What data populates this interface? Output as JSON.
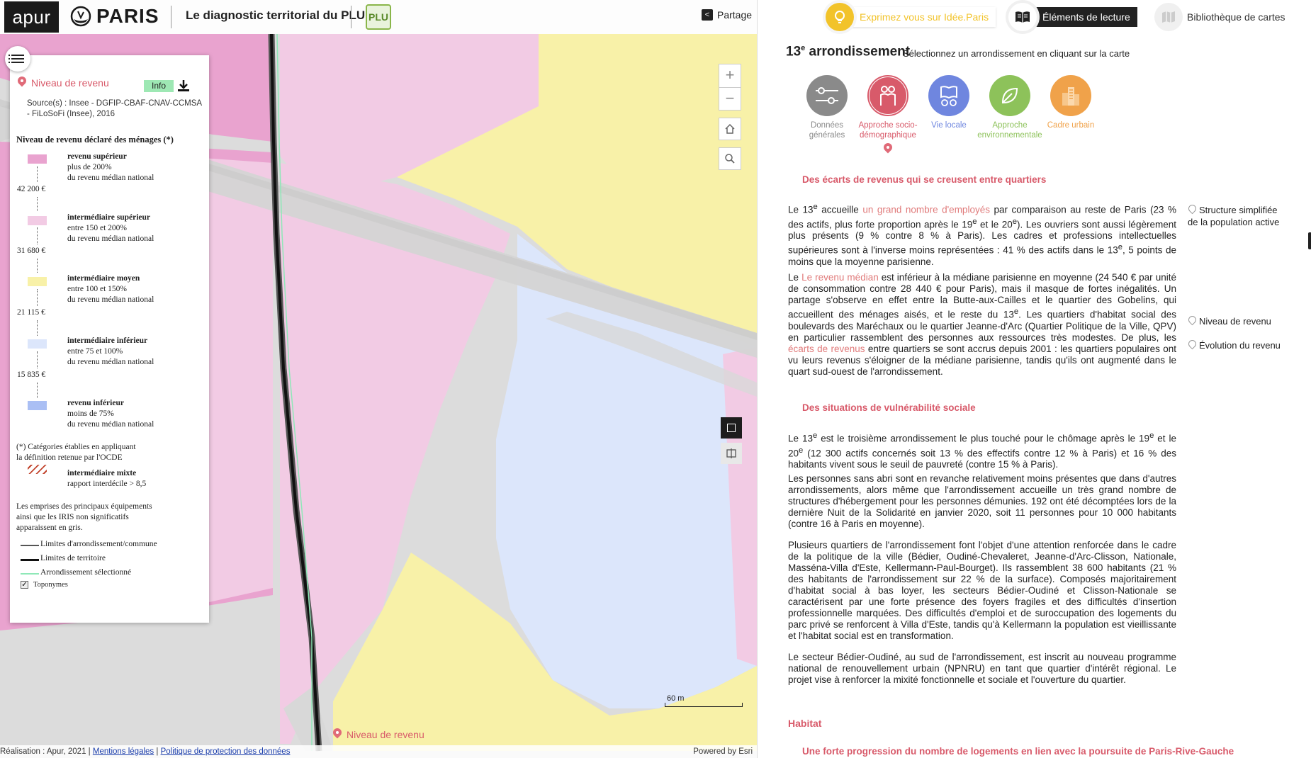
{
  "header": {
    "apur_logo": "apur",
    "paris_logo": "PARIS",
    "app_title": "Le diagnostic territorial du PLU",
    "plu_logo": "PLU",
    "share_label": "Partage"
  },
  "legend": {
    "layer_title": "Niveau de revenu",
    "info_label": "Info",
    "source": "Source(s) : Insee - DGFIP-CBAF-CNAV-CCMSA - FiLoSoFi (Insee), 2016",
    "subtitle": "Niveau de revenu déclaré des ménages (*)",
    "categories": [
      {
        "name": "revenu supérieur",
        "range": "plus de 200%",
        "ref": "du revenu médian national",
        "color": "#e9a3cf"
      },
      {
        "name": "intermédiaire supérieur",
        "range": "entre 150 et 200%",
        "ref": "du revenu médian national",
        "color": "#f2cbe4"
      },
      {
        "name": "intermédiaire moyen",
        "range": "entre 100 et 150%",
        "ref": "du revenu médian national",
        "color": "#f8f1a8"
      },
      {
        "name": "intermédiaire inférieur",
        "range": "entre 75 et 100%",
        "ref": "du revenu médian national",
        "color": "#dce6fb"
      },
      {
        "name": "revenu inférieur",
        "range": "moins de 75%",
        "ref": "du revenu médian national",
        "color": "#aabff4"
      }
    ],
    "thresholds": [
      "42 200 €",
      "31 680 €",
      "21 115 €",
      "15 835 €"
    ],
    "note_ocde_1": "(*) Catégories établies en appliquant",
    "note_ocde_2": "la définition retenue par l'OCDE",
    "mixte_name": "intermédiaire mixte",
    "mixte_desc": "rapport interdécile > 8,5",
    "grey_note_1": "Les emprises des principaux équipements",
    "grey_note_2": "ainsi que les IRIS non significatifs",
    "grey_note_3": "apparaissent en gris.",
    "lines": [
      {
        "label": "Limites d'arrondissement/commune",
        "color": "#555555"
      },
      {
        "label": "Limites de territoire",
        "color": "#111111"
      },
      {
        "label": "Arrondissement sélectionné",
        "color": "#8fe8b8"
      }
    ],
    "toponymes_label": "Toponymes"
  },
  "map": {
    "zoom_in": "+",
    "zoom_out": "−",
    "scale_label": "60 m",
    "bottom_layer_label": "Niveau de revenu"
  },
  "footer": {
    "realisation": "Réalisation : Apur, 2021 |",
    "legal": "Mentions légales",
    "sep": "|",
    "privacy": "Politique de protection des données",
    "powered": "Powered by Esri"
  },
  "panel": {
    "idea_label": "Exprimez vous sur Idée.Paris",
    "reading_label": "Éléments de lecture",
    "library_label": "Bibliothèque de cartes",
    "arr_number": "13",
    "arr_sup": "e",
    "arr_word": " arrondissement",
    "arr_hint": "Sélectionnez un arrondissement en cliquant sur la carte",
    "themes": [
      {
        "label1": "Données",
        "label2": "générales",
        "color": "#8a8a8a"
      },
      {
        "label1": "Approche socio-",
        "label2": "démographique",
        "color": "#d85a6a"
      },
      {
        "label1": "Vie locale",
        "label2": "",
        "color": "#6f86df"
      },
      {
        "label1": "Approche",
        "label2": "environnementale",
        "color": "#8dc25a"
      },
      {
        "label1": "Cadre urbain",
        "label2": "",
        "color": "#f0a24a"
      }
    ],
    "section1_title": "Des écarts de revenus qui se creusent entre quartiers",
    "p1_a": "Le 13",
    "p1_b": "e",
    "p1_c": " accueille ",
    "p1_link": "un grand nombre d'employés",
    "p1_d": " par comparaison au reste de Paris (23 % des actifs, plus forte proportion après le 19",
    "p1_e": "e",
    "p1_f": " et le 20",
    "p1_g": "e",
    "p1_h": "). Les ouvriers sont aussi légèrement plus présents (9 % contre 8 % à Paris). Les cadres et professions intellectuelles supérieures sont à l'inverse moins représentées : 41 % des actifs dans le 13",
    "p1_i": "e",
    "p1_j": ", 5 points de moins que la moyenne parisienne.",
    "p2_a": "Le ",
    "p2_link1": "Le revenu médian",
    "p2_b": " est inférieur à la médiane parisienne en moyenne (24 540 € par unité de consommation contre 28 440 € pour Paris), mais il masque de fortes inégalités. Un partage s'observe en effet entre la Butte-aux-Cailles et le quartier des Gobelins, qui accueillent des ménages aisés, et le reste du 13",
    "p2_c": "e",
    "p2_d": ". Les quartiers d'habitat social des boulevards des Maréchaux ou le quartier Jeanne-d'Arc (Quartier Politique de la Ville, QPV) en particulier rassemblent des personnes aux ressources très modestes. De plus, les ",
    "p2_link2": "écarts de revenus",
    "p2_e": " entre quartiers se sont accrus depuis 2001 : les quartiers populaires ont vu leurs revenus s'éloigner de la médiane parisienne, tandis qu'ils ont augmenté dans le quart sud-ouest de l'arrondissement.",
    "section2_title": "Des situations de vulnérabilité sociale",
    "p3_a": "Le 13",
    "p3_b": "e",
    "p3_c": " est le troisième arrondissement le plus touché pour le chômage après le 19",
    "p3_d": "e",
    "p3_e": " et le 20",
    "p3_f": "e",
    "p3_g": " (12 300 actifs concernés soit 13 % des effectifs contre 12 % à Paris) et 16 % des habitants vivent sous le seuil de pauvreté (contre 15 % à Paris).",
    "p4": "Les personnes sans abri sont en revanche relativement moins présentes que dans d'autres arrondissements, alors même que l'arrondissement accueille un très grand nombre de structures d'hébergement pour les personnes démunies. 192 ont été décomptées lors de la dernière Nuit de la Solidarité en janvier 2020, soit 11 personnes pour 10 000 habitants (contre 16 à Paris en moyenne).",
    "p5": "Plusieurs quartiers de l'arrondissement font l'objet d'une attention renforcée dans le cadre de la politique de la ville (Bédier, Oudiné-Chevaleret, Jeanne-d'Arc-Clisson, Nationale, Masséna-Villa d'Este, Kellermann-Paul-Bourget). Ils rassemblent 38 600 habitants (21 % des habitants de l'arrondissement sur 22 % de la surface). Composés majoritairement d'habitat social à bas loyer, les secteurs Bédier-Oudiné et Clisson-Nationale se caractérisent par une forte présence des foyers fragiles et des difficultés d'insertion professionnelle marquées. Des difficultés d'emploi et de suroccupation des logements du parc privé se renforcent à Villa d'Este, tandis qu'à Kellermann la population est vieillissante et l'habitat social est en transformation.",
    "p6": "Le secteur Bédier-Oudiné, au sud de l'arrondissement, est inscrit au nouveau programme national de renouvellement urbain (NPNRU) en tant que quartier d'intérêt régional. Le projet vise à renforcer la mixité fonctionnelle et sociale et l'ouverture du quartier.",
    "habitat_title": "Habitat",
    "section3_title": "Une forte progression du nombre de logements en lien avec la poursuite de Paris-Rive-Gauche",
    "side_links": [
      {
        "label1": "Structure simplifiée",
        "label2": "de la population active"
      },
      {
        "label1": "Niveau de revenu",
        "label2": ""
      },
      {
        "label1": "Évolution du revenu",
        "label2": ""
      }
    ]
  }
}
